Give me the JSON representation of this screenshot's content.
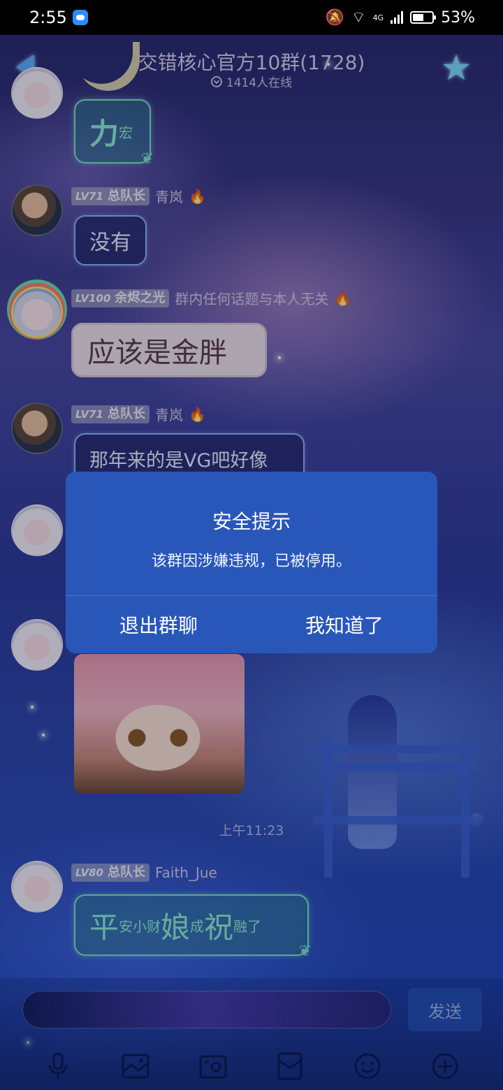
{
  "status_bar": {
    "time": "2:55",
    "network": "4G",
    "battery": "53%"
  },
  "header": {
    "title": "交错核心官方10群(1728)",
    "online": "1414人在线"
  },
  "messages": [
    {
      "type": "text",
      "segments": [
        {
          "text": "力",
          "size": "big"
        },
        {
          "text": "宏",
          "size": "small"
        }
      ]
    },
    {
      "type": "text",
      "level": "LV71",
      "title": "总队长",
      "nick": "青岚",
      "text": "没有"
    },
    {
      "type": "text",
      "level": "LV100",
      "title": "余烬之光",
      "nick": "群内任何话题与本人无关",
      "text": "应该是金胖"
    },
    {
      "type": "text",
      "level": "LV71",
      "title": "总队长",
      "nick": "青岚",
      "text": "那年来的是VG吧好像"
    },
    {
      "type": "image"
    },
    {
      "type": "time",
      "text": "上午11:23"
    },
    {
      "type": "text",
      "level": "LV80",
      "title": "总队长",
      "nick": "Faith_Jue",
      "segments": [
        {
          "text": "平",
          "size": "big"
        },
        {
          "text": "安小财",
          "size": "small"
        },
        {
          "text": "娘",
          "size": "big"
        },
        {
          "text": "成",
          "size": "small"
        },
        {
          "text": "祝",
          "size": "big"
        },
        {
          "text": "融了",
          "size": "small"
        }
      ]
    }
  ],
  "dialog": {
    "title": "安全提示",
    "message": "该群因涉嫌违规，已被停用。",
    "left_button": "退出群聊",
    "right_button": "我知道了"
  },
  "input": {
    "send_label": "发送"
  },
  "toolbar_icons": [
    "microphone-icon",
    "image-icon",
    "camera-icon",
    "red-packet-icon",
    "emoji-icon",
    "plus-icon"
  ],
  "colors": {
    "dialog_bg": "#2957b9",
    "back_arrow": "#5eb0ff",
    "flame": "#ff8a3a"
  }
}
